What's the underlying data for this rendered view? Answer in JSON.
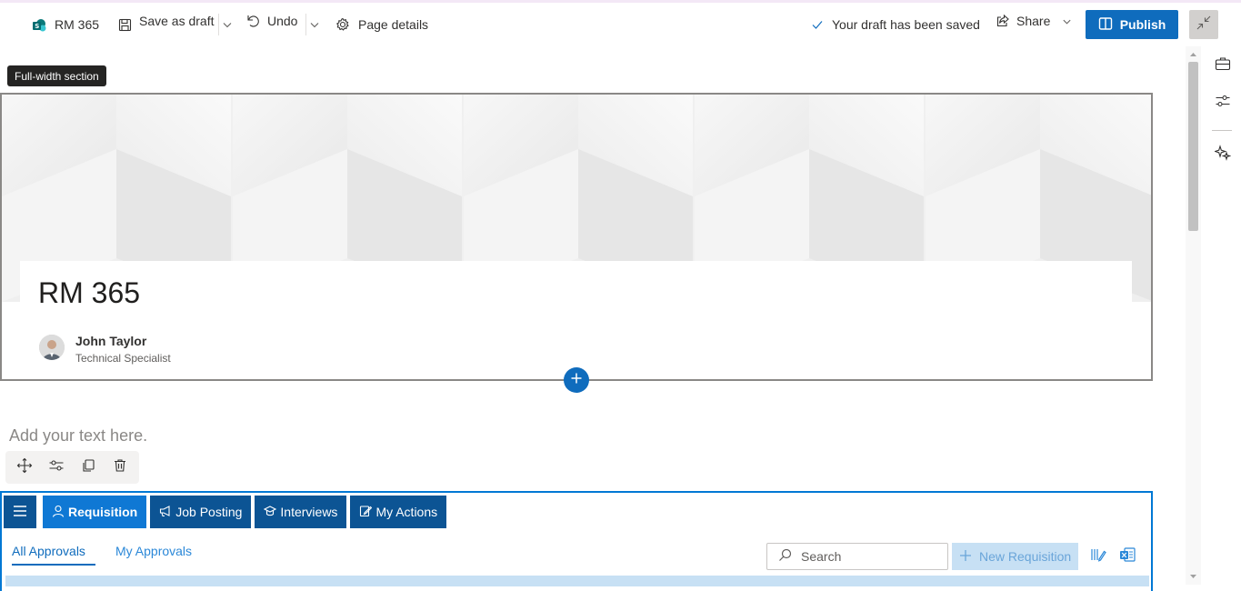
{
  "command_bar": {
    "site_name": "RM 365",
    "save_draft_label": "Save as draft",
    "undo_label": "Undo",
    "page_details_label": "Page details",
    "status_text": "Your draft has been saved",
    "share_label": "Share",
    "publish_label": "Publish"
  },
  "tooltip": {
    "text": "Full-width section"
  },
  "title_area": {
    "page_title": "RM 365",
    "author_name": "John Taylor",
    "author_role": "Technical Specialist"
  },
  "text_section": {
    "placeholder": "Add your text here."
  },
  "webpart": {
    "tabs": [
      {
        "label": "Requisition",
        "icon": "person-icon",
        "active": true
      },
      {
        "label": "Job Posting",
        "icon": "megaphone-icon",
        "active": false
      },
      {
        "label": "Interviews",
        "icon": "interview-icon",
        "active": false
      },
      {
        "label": "My Actions",
        "icon": "edit-note-icon",
        "active": false
      }
    ],
    "subtabs": {
      "all_approvals": "All Approvals",
      "my_approvals": "My Approvals"
    },
    "search_placeholder": "Search",
    "new_requisition_label": "New Requisition"
  },
  "colors": {
    "primary": "#0f6cbd",
    "tab_dark": "#0c5494",
    "tab_active": "#0f78d4",
    "selection_border": "#0078d4"
  }
}
